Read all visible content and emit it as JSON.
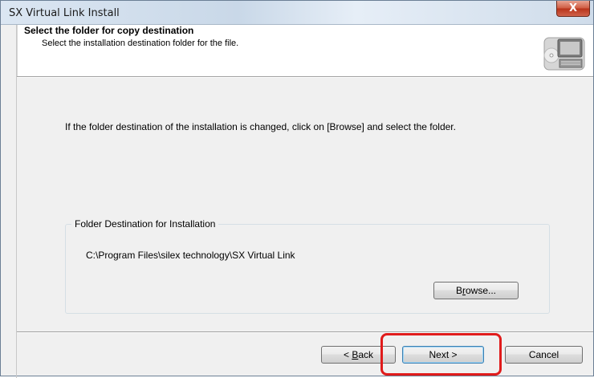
{
  "window": {
    "title": "SX Virtual Link Install",
    "close_glyph": "X"
  },
  "header": {
    "title": "Select the folder for copy destination",
    "subtitle": "Select the installation destination folder for the file.",
    "icon": "computer-icon"
  },
  "body": {
    "instruction": "If the folder destination of the installation is changed, click on [Browse] and select the folder."
  },
  "group": {
    "legend": "Folder Destination for Installation",
    "path": "C:\\Program Files\\silex technology\\SX Virtual Link",
    "browse_label_prefix": "B",
    "browse_label_mnemonic": "r",
    "browse_label_suffix": "owse..."
  },
  "footer": {
    "back_prefix": "< ",
    "back_mnemonic": "B",
    "back_suffix": "ack",
    "next_label": "Next >",
    "cancel_label": "Cancel"
  },
  "colors": {
    "highlight": "#e01b1b",
    "dialog_bg": "#f0f0f0",
    "header_bg": "#ffffff"
  }
}
